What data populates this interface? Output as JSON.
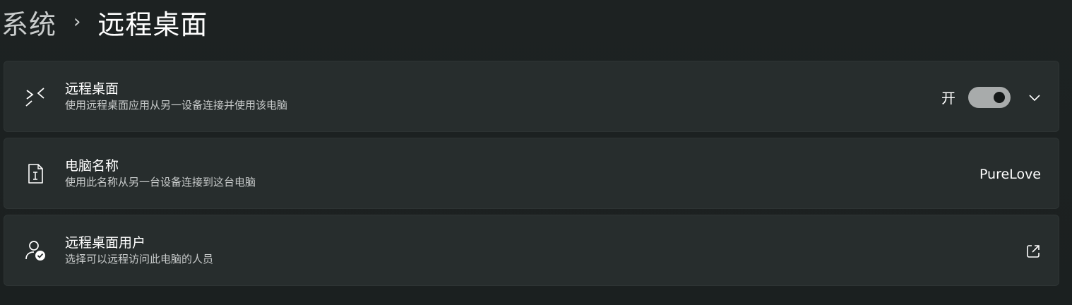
{
  "breadcrumb": {
    "parent": "系统",
    "separator": "›",
    "current": "远程桌面"
  },
  "cards": [
    {
      "title": "远程桌面",
      "subtitle": "使用远程桌面应用从另一设备连接并使用该电脑",
      "icon": "remote-desktop-icon",
      "toggle_label": "开",
      "toggle_on": true
    },
    {
      "title": "电脑名称",
      "subtitle": "使用此名称从另一台设备连接到这台电脑",
      "icon": "pc-name-icon",
      "value": "PureLove"
    },
    {
      "title": "远程桌面用户",
      "subtitle": "选择可以远程访问此电脑的人员",
      "icon": "user-check-icon",
      "action_icon": "open-external-icon"
    }
  ],
  "colors": {
    "background": "#1c2121",
    "card": "#272d2d",
    "toggle_on": "#a8abab"
  }
}
